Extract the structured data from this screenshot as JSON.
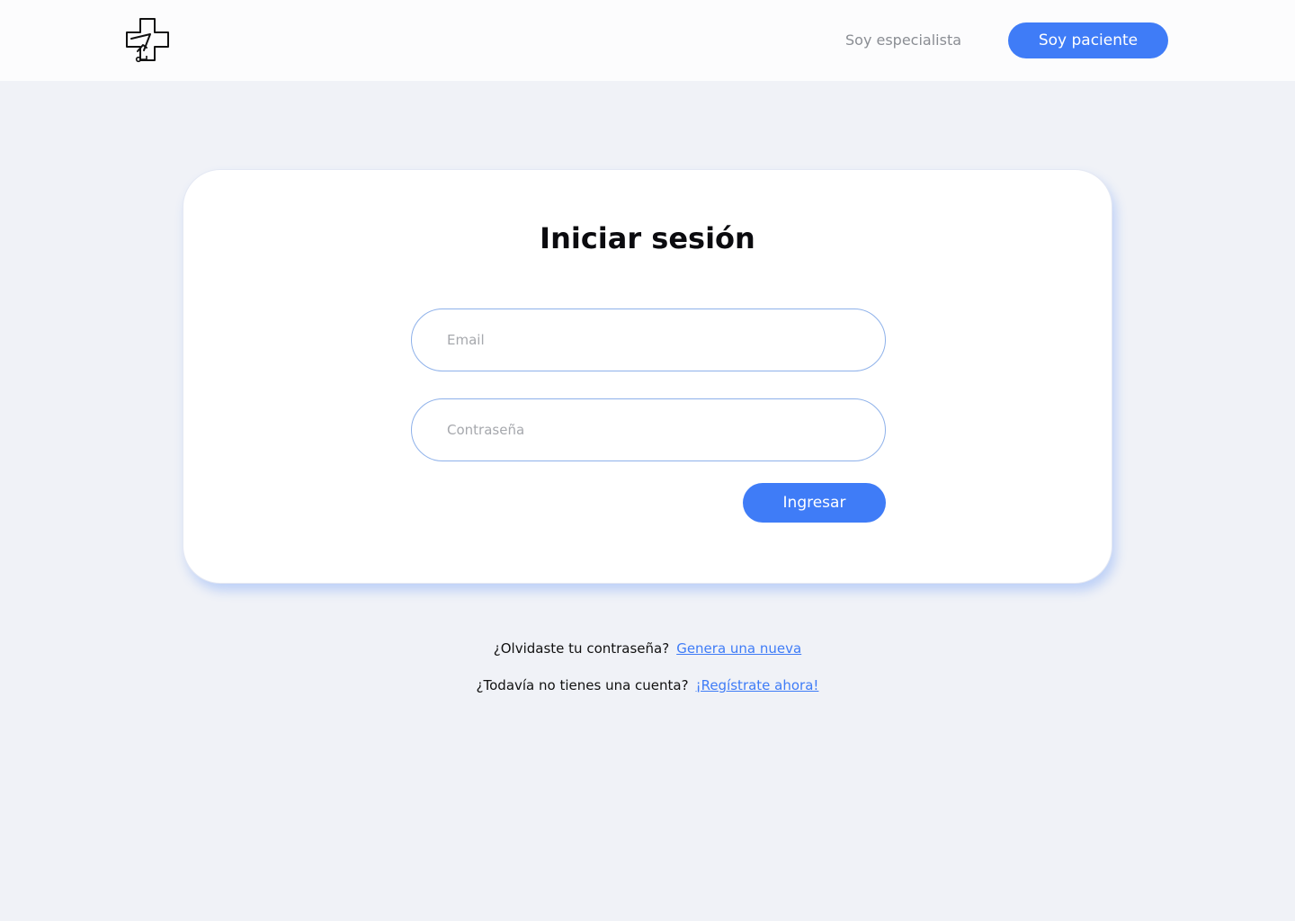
{
  "header": {
    "logo_icon": "medical-cross-logo-icon",
    "specialist_link": "Soy especialista",
    "patient_button": "Soy paciente"
  },
  "login_card": {
    "title": "Iniciar sesión",
    "email_placeholder": "Email",
    "email_value": "",
    "password_placeholder": "Contraseña",
    "password_value": "",
    "submit_label": "Ingresar"
  },
  "footer_links": {
    "forgot_text": "¿Olvidaste tu contraseña?",
    "forgot_link": "Genera una nueva",
    "no_account_text": "¿Todavía no tienes una cuenta?",
    "register_link": "¡Regístrate ahora!"
  },
  "colors": {
    "accent": "#3F7CF7",
    "background": "#F0F2F7",
    "header_background": "#FCFCFD",
    "card_background": "#FFFFFF",
    "input_border": "#8EB1EA"
  }
}
